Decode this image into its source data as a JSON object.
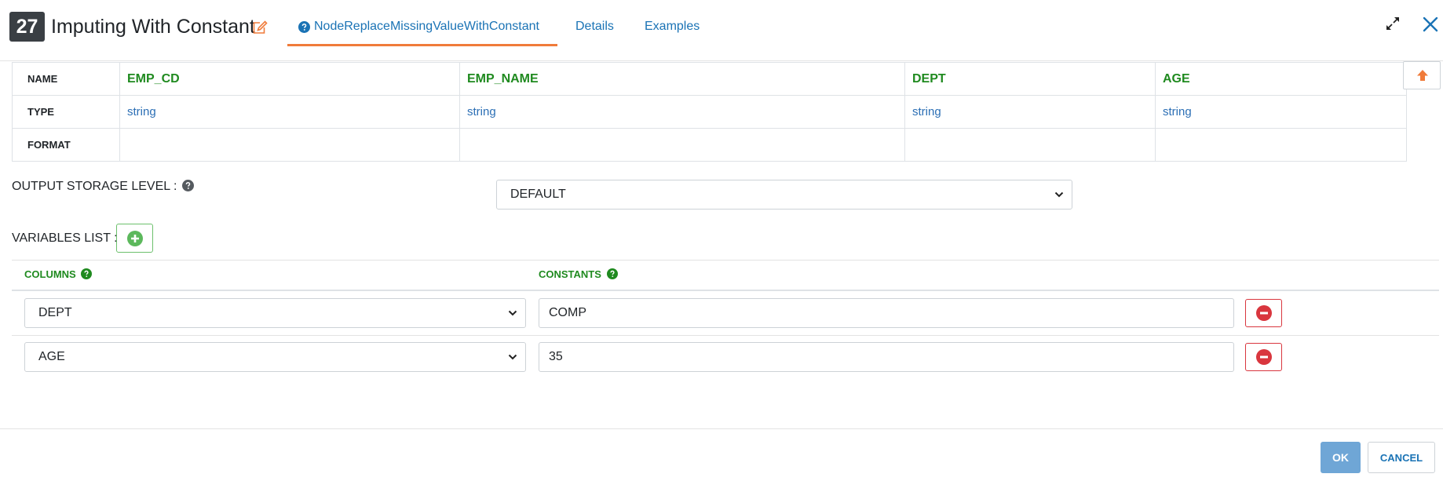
{
  "header": {
    "node_number": "27",
    "title": "Imputing With Constant",
    "tabs": [
      {
        "label": "NodeReplaceMissingValueWithConstant",
        "active": true
      },
      {
        "label": "Details",
        "active": false
      },
      {
        "label": "Examples",
        "active": false
      }
    ]
  },
  "schema": {
    "row_labels": {
      "name": "NAME",
      "type": "TYPE",
      "format": "FORMAT"
    },
    "columns": [
      {
        "name": "EMP_CD",
        "type": "string",
        "format": ""
      },
      {
        "name": "EMP_NAME",
        "type": "string",
        "format": ""
      },
      {
        "name": "DEPT",
        "type": "string",
        "format": ""
      },
      {
        "name": "AGE",
        "type": "string",
        "format": ""
      }
    ]
  },
  "output_storage": {
    "label": "OUTPUT STORAGE LEVEL :",
    "value": "DEFAULT"
  },
  "variables": {
    "label": "VARIABLES LIST :",
    "columns_header": "COLUMNS",
    "constants_header": "CONSTANTS",
    "rows": [
      {
        "column": "DEPT",
        "constant": "COMP"
      },
      {
        "column": "AGE",
        "constant": "35"
      }
    ]
  },
  "footer": {
    "ok_label": "OK",
    "cancel_label": "CANCEL"
  },
  "colors": {
    "accent_orange": "#f07b3a",
    "link_blue": "#1a73b5",
    "column_green": "#1f8a1f",
    "danger_red": "#d9363e",
    "ok_blue": "#6fa6d6",
    "badge_dark": "#3a3f44"
  }
}
